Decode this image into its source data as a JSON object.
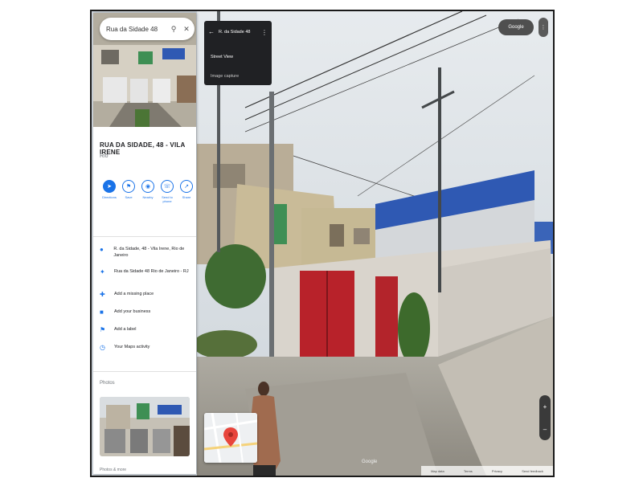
{
  "search": {
    "value": "Rua da Sidade 48"
  },
  "panel": {
    "title": "RUA DA SIDADE, 48 - VILA IRENE",
    "subtitle": "Rio",
    "actions": [
      {
        "label": "Directions"
      },
      {
        "label": "Save"
      },
      {
        "label": "Nearby"
      },
      {
        "label": "Send to phone"
      },
      {
        "label": "Share"
      }
    ],
    "info": [
      {
        "icon": "location-pin-icon",
        "text": "R. da Sidade, 48 - Vila Irene, Rio de Janeiro"
      },
      {
        "icon": "plus-code-icon",
        "text": "Rua da Sidade 48 Rio de Janeiro - RJ"
      },
      {
        "icon": "add-place-icon",
        "text": "Add a missing place"
      },
      {
        "icon": "business-icon",
        "text": "Add your business"
      },
      {
        "icon": "label-icon",
        "text": "Add a label"
      },
      {
        "icon": "history-icon",
        "text": "Your Maps activity"
      }
    ],
    "photos_label": "Photos",
    "bottom_label": "Photos & more"
  },
  "overlay": {
    "card_title": "R. da Sidade 48",
    "card_location": "Street View",
    "card_date": "Image capture",
    "pill_label": "Google",
    "google_mark": "Google"
  },
  "footer": [
    "Map data",
    "Terms",
    "Privacy",
    "Send feedback"
  ],
  "colors": {
    "accent": "#1a73e8",
    "door": "#b8222a",
    "roof": "#2f59b3"
  }
}
